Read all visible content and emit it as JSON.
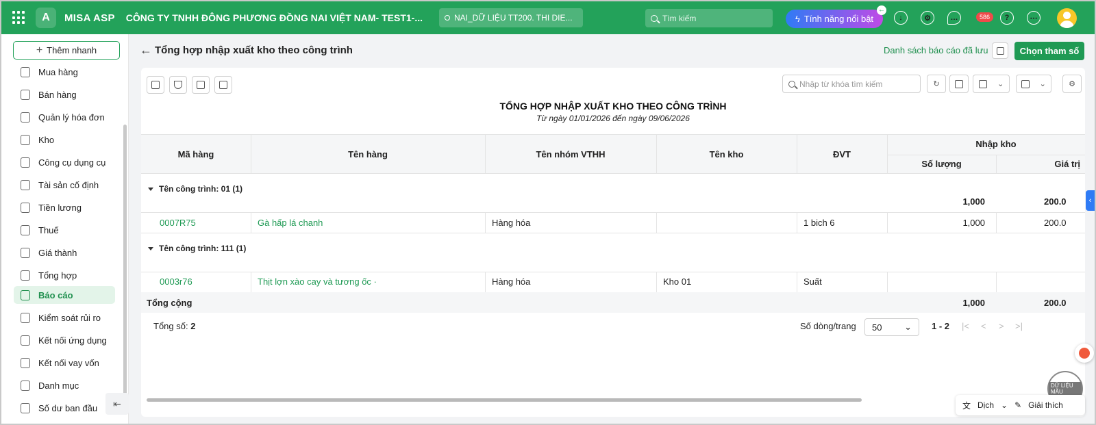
{
  "topbar": {
    "brand": "MISA ASP",
    "company": "CÔNG TY TNHH ĐÔNG PHƯƠNG ĐỒNG NAI VIỆT NAM- TEST1-...",
    "database": "NAI_DỮ LIỆU TT200. THI DIE...",
    "search_placeholder": "Tìm kiếm",
    "feature_label": "Tính năng nổi bật",
    "notification_count": "586"
  },
  "sidebar": {
    "quick_add": "Thêm nhanh",
    "items": [
      {
        "label": "Mua hàng"
      },
      {
        "label": "Bán hàng"
      },
      {
        "label": "Quản lý hóa đơn"
      },
      {
        "label": "Kho"
      },
      {
        "label": "Công cụ dụng cụ"
      },
      {
        "label": "Tài sản cố định"
      },
      {
        "label": "Tiền lương"
      },
      {
        "label": "Thuế"
      },
      {
        "label": "Giá thành"
      },
      {
        "label": "Tổng hợp"
      },
      {
        "label": "Báo cáo"
      },
      {
        "label": "Kiểm soát rủi ro"
      },
      {
        "label": "Kết nối ứng dụng"
      },
      {
        "label": "Kết nối vay vốn"
      },
      {
        "label": "Danh mục"
      },
      {
        "label": "Số dư ban đầu"
      }
    ],
    "active_item": "Báo cáo"
  },
  "header": {
    "title": "Tổng hợp nhập xuất kho theo công trình",
    "saved_reports": "Danh sách báo cáo đã lưu",
    "choose_params": "Chọn tham số"
  },
  "report": {
    "search_placeholder": "Nhập từ khóa tìm kiếm",
    "title": "TỔNG HỢP NHẬP XUẤT KHO THEO CÔNG TRÌNH",
    "subtitle": "Từ ngày 01/01/2026 đến ngày 09/06/2026",
    "columns": {
      "code": "Mã hàng",
      "name": "Tên hàng",
      "group": "Tên nhóm VTHH",
      "warehouse": "Tên kho",
      "unit": "ĐVT",
      "import_group": "Nhập kho",
      "quantity": "Số lượng",
      "value": "Giá trị"
    },
    "groups": [
      {
        "label": "Tên công trình: 01 (1)",
        "subtotal_qty": "1,000",
        "subtotal_value": "200.0",
        "row": {
          "code": "0007R75",
          "name": "Gà hấp lá chanh",
          "group": "Hàng hóa",
          "warehouse": "",
          "unit": "1 bich 6",
          "qty": "1,000",
          "value": "200.0"
        }
      },
      {
        "label": "Tên công trình: 111 (1)",
        "subtotal_qty": "",
        "subtotal_value": "",
        "row": {
          "code": "0003r76",
          "name": "Thịt lợn xào cay và tương ốc ·",
          "group": "Hàng hóa",
          "warehouse": "Kho 01",
          "unit": "Suất",
          "qty": "",
          "value": ""
        }
      }
    ],
    "total": {
      "label": "Tổng cộng",
      "qty": "1,000",
      "value": "200.0"
    }
  },
  "pager": {
    "total_label": "Tổng số:",
    "total_value": "2",
    "rows_per_page_label": "Số dòng/trang",
    "rows_per_page": "50",
    "range": "1 - 2"
  },
  "bottom_bar": {
    "translate": "Dịch",
    "explain": "Giải thích"
  },
  "stamp_text": "DỮ LIỆU MẪU",
  "colors": {
    "brand_green": "#23a25a",
    "link_green": "#1f9a54",
    "feature_gradient_start": "#2f7bf5",
    "feature_gradient_end": "#c04ae6",
    "badge_red": "#ef4a4a"
  }
}
